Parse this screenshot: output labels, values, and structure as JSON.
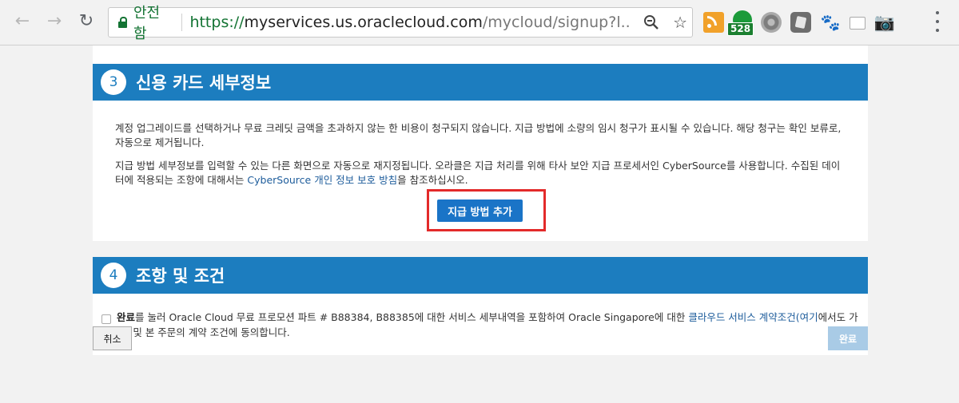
{
  "browser": {
    "back_icon": "back-arrow-icon",
    "forward_icon": "forward-arrow-icon",
    "reload_icon": "reload-icon",
    "secure_label": "안전함",
    "url_scheme": "https://",
    "url_host": "myservices.us.oraclecloud.com",
    "url_path": "/mycloud/signup?l...",
    "zoom_icon": "zoom-icon",
    "bookmark_icon": "star-icon",
    "extensions": [
      "rss-icon",
      "badge-extension-icon",
      "gear-icon",
      "pocket-icon",
      "paw-icon",
      "window-icon",
      "camera-icon"
    ],
    "extension_badge_count": "528",
    "menu_icon": "menu-dots-icon"
  },
  "payment_section": {
    "step": "3",
    "title": "신용 카드 세부정보",
    "para1": "계정 업그레이드를 선택하거나 무료 크레딧 금액을 초과하지 않는 한 비용이 청구되지 않습니다. 지급 방법에 소량의 임시 청구가 표시될 수 있습니다. 해당 청구는 확인 보류로, 자동으로 제거됩니다.",
    "para2_before": "지급 방법 세부정보를 입력할 수 있는 다른 화면으로 자동으로 재지정됩니다. 오라클은 지급 처리를 위해 타사 보안 지급 프로세서인 CyberSource를 사용합니다. 수집된 데이터에 적용되는 조항에 대해서는 ",
    "para2_link": "CyberSource 개인 정보 보호 방침",
    "para2_after": "을 참조하십시오.",
    "add_payment_button": "지급 방법 추가"
  },
  "terms_section": {
    "step": "4",
    "title": "조항 및 조건",
    "bold_word": "완료",
    "text_before": "를 눌러 Oracle Cloud 무료 프로모션 파트 # B88384, B88385에 대한 서비스 세부내역을 포함하여 Oracle Singapore에 대한 ",
    "link1": "클라우드 서비스 계약조건",
    "link2": "(여기",
    "text_after": "에서도 가능) 및 본 주문의 계약 조건에 동의합니다.",
    "checked": false
  },
  "footer": {
    "cancel_button": "취소",
    "done_button": "완료"
  },
  "colors": {
    "header_blue": "#1c7dbf",
    "button_blue": "#1a74c7",
    "highlight_red": "#e32a2a",
    "disabled_blue": "#a9cbe6"
  }
}
